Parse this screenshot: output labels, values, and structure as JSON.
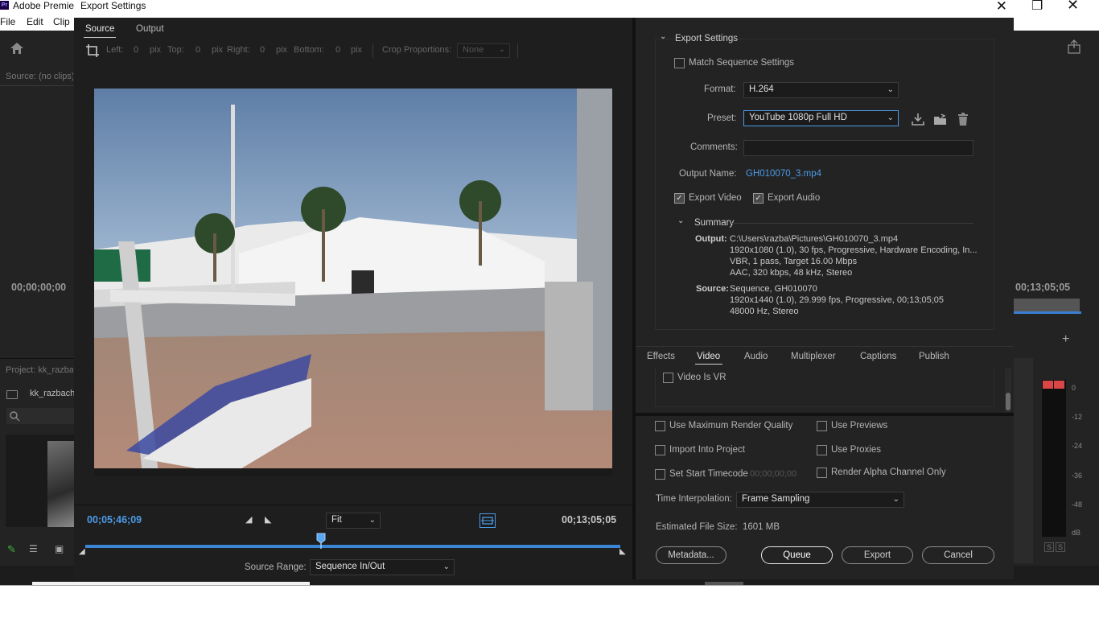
{
  "app": {
    "title": "Adobe Premie",
    "logo": "Pr",
    "menus": [
      "File",
      "Edit",
      "Clip"
    ],
    "source_label": "Source: (no clips)",
    "timecode_left": "00;00;00;00",
    "timecode_right": "00;13;05;05",
    "project_label": "Project: kk_razba",
    "bin_name": "kk_razbach"
  },
  "meters": {
    "ticks": [
      "0",
      "-12",
      "-24",
      "-36",
      "-48",
      "dB"
    ],
    "solo": [
      "S",
      "S"
    ]
  },
  "dialog": {
    "title": "Export Settings",
    "tabs": [
      {
        "label": "Source",
        "active": true
      },
      {
        "label": "Output",
        "active": false
      }
    ],
    "crop": {
      "left_label": "Left:",
      "left_value": "0",
      "top_label": "Top:",
      "top_value": "0",
      "right_label": "Right:",
      "right_value": "0",
      "bottom_label": "Bottom:",
      "bottom_value": "0",
      "unit": "pix",
      "proportions_label": "Crop Proportions:",
      "proportions_value": "None"
    },
    "transport": {
      "current_time": "00;05;46;09",
      "duration": "00;13;05;05",
      "zoom": "Fit",
      "source_range_label": "Source Range:",
      "source_range_value": "Sequence In/Out",
      "playhead_fraction": 0.44
    }
  },
  "export_settings": {
    "header": "Export Settings",
    "match_sequence": "Match Sequence Settings",
    "format_label": "Format:",
    "format_value": "H.264",
    "preset_label": "Preset:",
    "preset_value": "YouTube 1080p Full HD",
    "comments_label": "Comments:",
    "comments_value": "",
    "output_name_label": "Output Name:",
    "output_name_value": "GH010070_3.mp4",
    "export_video": "Export Video",
    "export_audio": "Export Audio",
    "summary_header": "Summary",
    "output_label": "Output:",
    "output_lines": [
      "C:\\Users\\razba\\Pictures\\GH010070_3.mp4",
      "1920x1080 (1.0), 30 fps, Progressive, Hardware Encoding, In...",
      "VBR, 1 pass, Target 16.00 Mbps",
      "AAC, 320 kbps, 48 kHz, Stereo"
    ],
    "source_label": "Source:",
    "source_lines": [
      "Sequence, GH010070",
      "1920x1440 (1.0), 29.999 fps, Progressive, 00;13;05;05",
      "48000 Hz, Stereo"
    ]
  },
  "settings_tabs": [
    {
      "label": "Effects",
      "active": false
    },
    {
      "label": "Video",
      "active": true
    },
    {
      "label": "Audio",
      "active": false
    },
    {
      "label": "Multiplexer",
      "active": false
    },
    {
      "label": "Captions",
      "active": false
    },
    {
      "label": "Publish",
      "active": false
    }
  ],
  "video_tab": {
    "video_is_vr": "Video Is VR"
  },
  "options": {
    "max_render_quality": "Use Maximum Render Quality",
    "use_previews": "Use Previews",
    "import_into_project": "Import Into Project",
    "use_proxies": "Use Proxies",
    "set_start_timecode": "Set Start Timecode",
    "start_timecode_value": "00;00;00;00",
    "render_alpha": "Render Alpha Channel Only",
    "time_interpolation_label": "Time Interpolation:",
    "time_interpolation_value": "Frame Sampling",
    "estimated_size_label": "Estimated File Size:",
    "estimated_size_value": "1601 MB"
  },
  "buttons": {
    "metadata": "Metadata...",
    "queue": "Queue",
    "export": "Export",
    "cancel": "Cancel"
  },
  "colors": {
    "accent": "#4c9be8",
    "panel": "#232323"
  }
}
